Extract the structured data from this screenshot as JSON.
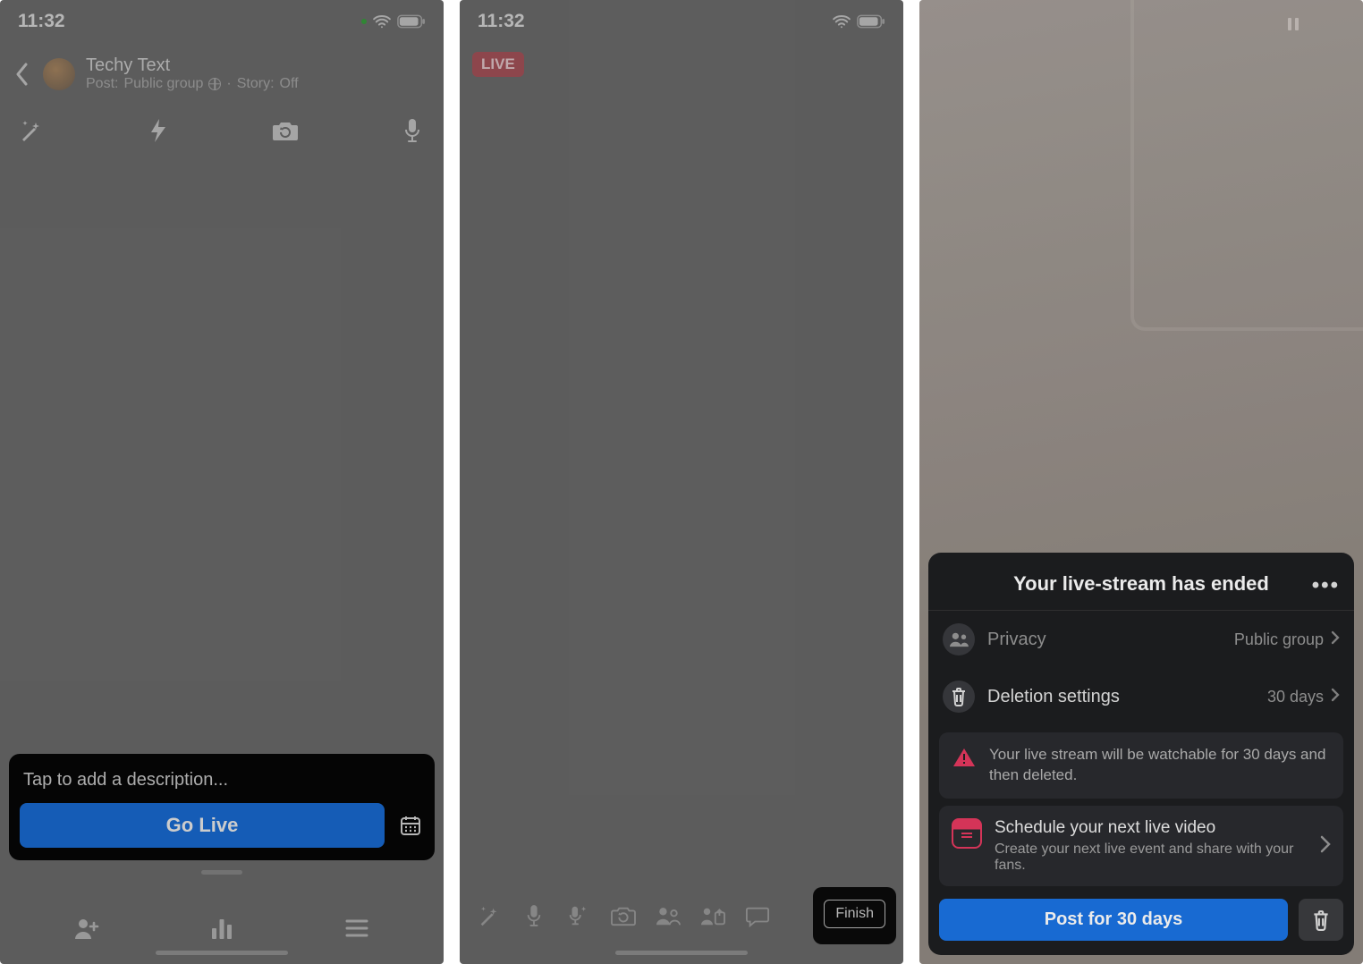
{
  "status": {
    "time": "11:32"
  },
  "screen1": {
    "profile_name": "Techy Text",
    "post_label": "Post:",
    "post_value": "Public group",
    "story_label": "Story:",
    "story_value": "Off",
    "desc_placeholder": "Tap to add a description...",
    "go_live_label": "Go Live"
  },
  "screen2": {
    "live_badge": "LIVE",
    "finish_label": "Finish"
  },
  "screen3": {
    "sheet_title": "Your live-stream has ended",
    "privacy_label": "Privacy",
    "privacy_value": "Public group",
    "deletion_label": "Deletion settings",
    "deletion_value": "30 days",
    "info_text": "Your live stream will be watchable for 30 days and then deleted.",
    "schedule_title": "Schedule your next live video",
    "schedule_sub": "Create your next live event and share with your fans.",
    "post_label": "Post for 30 days"
  }
}
